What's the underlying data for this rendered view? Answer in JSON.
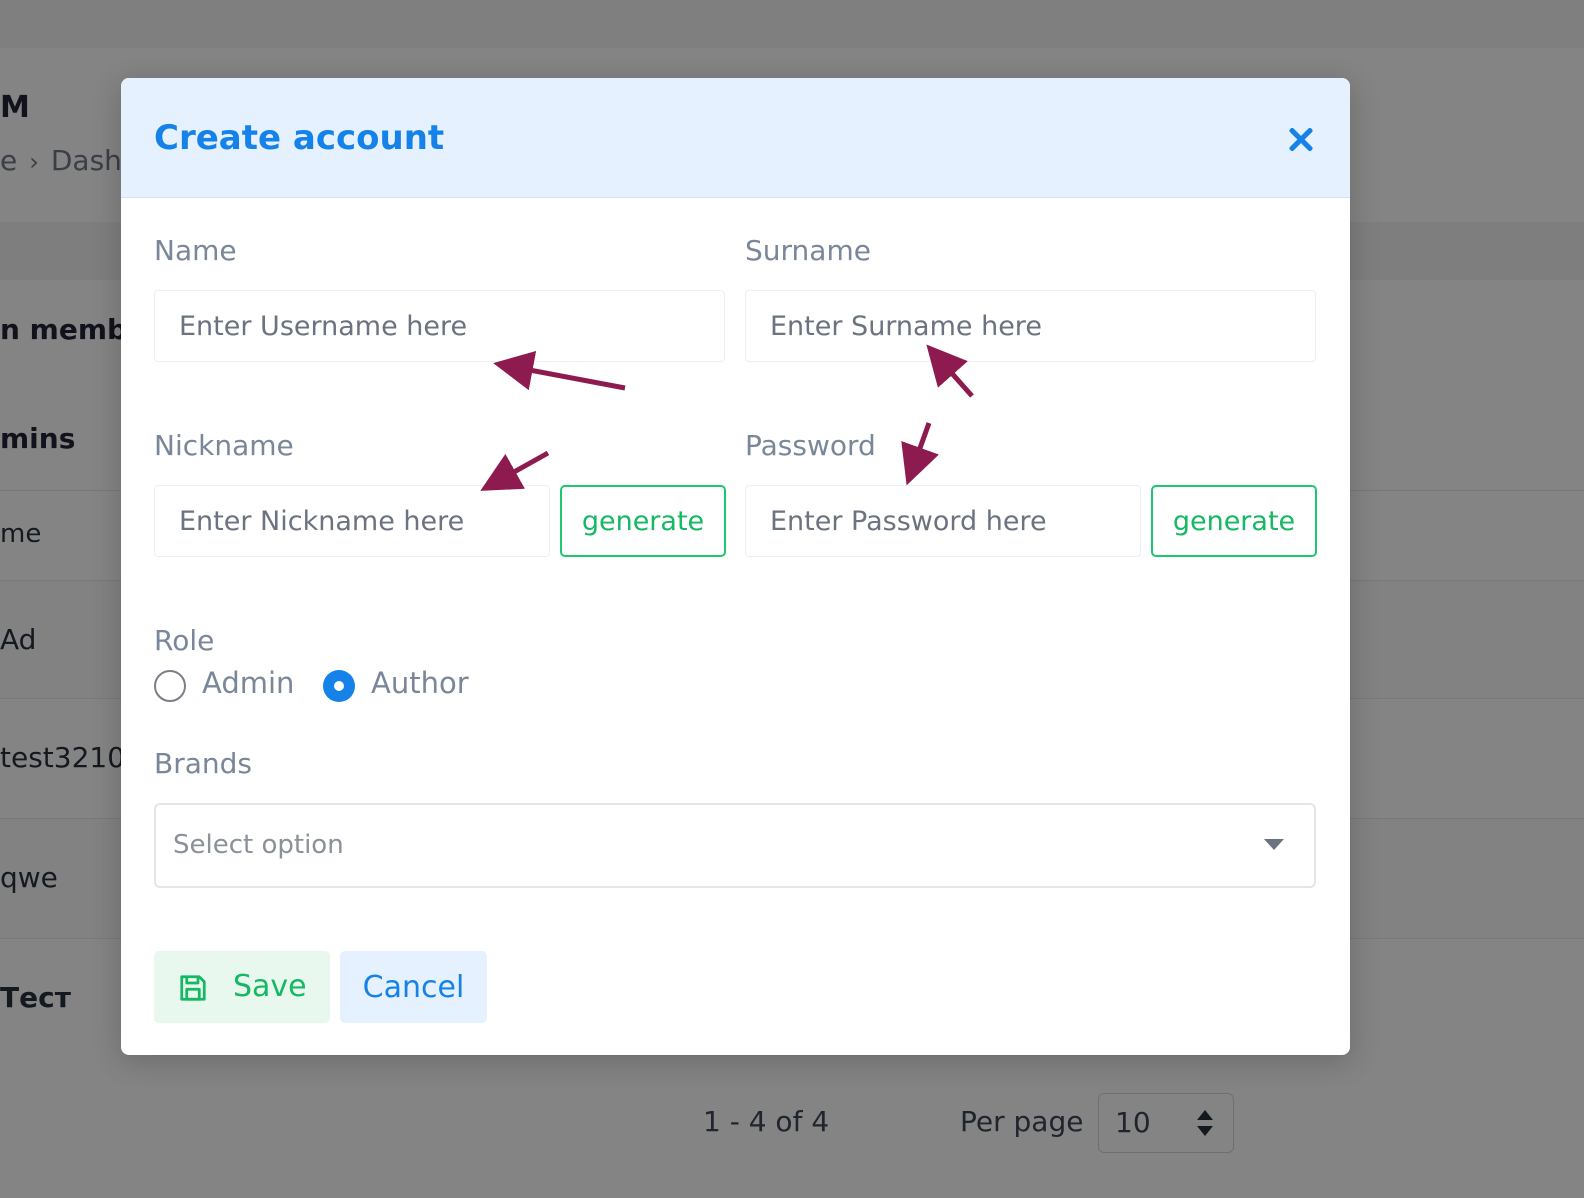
{
  "background": {
    "title_fragment": "M",
    "breadcrumb": {
      "home_fragment": "e",
      "current_fragment": "Dash"
    },
    "section_heading_fragment": "n memb",
    "sub_heading_fragment": "mins",
    "column_header_fragment": "me",
    "rows": [
      {
        "name_fragment": "Ad"
      },
      {
        "name_fragment": "test3210"
      },
      {
        "name_fragment": "qwe"
      },
      {
        "name_fragment": "Тест"
      }
    ],
    "pagination": {
      "range_text": "1 - 4 of 4",
      "per_page_label": "Per page",
      "per_page_value": "10"
    }
  },
  "modal": {
    "title": "Create account",
    "close_icon": "close-icon",
    "fields": {
      "name": {
        "label": "Name",
        "placeholder": "Enter Username here",
        "value": ""
      },
      "surname": {
        "label": "Surname",
        "placeholder": "Enter Surname here",
        "value": ""
      },
      "nickname": {
        "label": "Nickname",
        "placeholder": "Enter Nickname here",
        "value": "",
        "generate_label": "generate"
      },
      "password": {
        "label": "Password",
        "placeholder": "Enter Password here",
        "value": "",
        "generate_label": "generate"
      }
    },
    "role": {
      "label": "Role",
      "options": [
        {
          "label": "Admin",
          "checked": false
        },
        {
          "label": "Author",
          "checked": true
        }
      ],
      "selected": "Author"
    },
    "brands": {
      "label": "Brands",
      "placeholder": "Select option",
      "icon": "chevron-down-icon"
    },
    "actions": {
      "save_label": "Save",
      "save_icon": "save-icon",
      "cancel_label": "Cancel"
    }
  },
  "colors": {
    "primary": "#1482e8",
    "header_bg": "#e5f1ff",
    "success": "#16b864",
    "success_bg": "#e8f8ef",
    "annotation_arrow": "#8e1b4f",
    "label_gray": "#7a8799"
  },
  "annotations": {
    "arrow_count": 5,
    "description_icon": "annotation-arrow"
  }
}
